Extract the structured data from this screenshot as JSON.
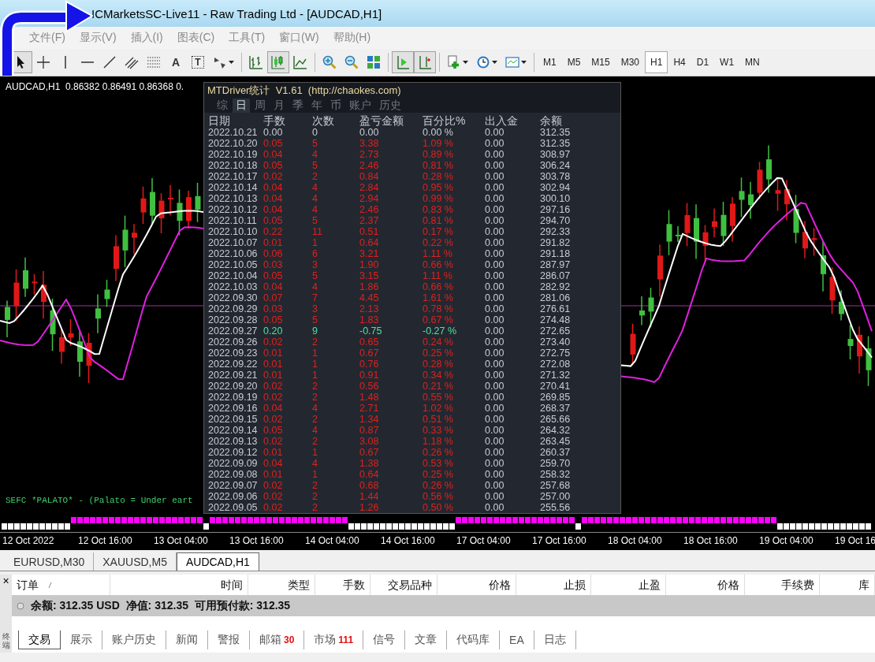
{
  "window": {
    "title": "ICMarketsSC-Live11 - Raw Trading Ltd - [AUDCAD,H1]"
  },
  "menu": [
    "文件(F)",
    "显示(V)",
    "插入(I)",
    "图表(C)",
    "工具(T)",
    "窗口(W)",
    "帮助(H)"
  ],
  "toolbar": {
    "tool_groups": [
      [
        {
          "kind": "cursor",
          "pressed": true
        },
        {
          "kind": "crosshair",
          "pressed": false
        },
        {
          "kind": "vline",
          "pressed": false
        },
        {
          "kind": "hline",
          "pressed": false
        },
        {
          "kind": "trendline",
          "pressed": false
        },
        {
          "kind": "channel",
          "pressed": false
        },
        {
          "kind": "fibo",
          "pressed": false
        },
        {
          "kind": "text",
          "label": "A",
          "pressed": false
        },
        {
          "kind": "textlabel",
          "label": "T",
          "pressed": false
        },
        {
          "kind": "arrows",
          "dropdown": true,
          "pressed": false
        }
      ],
      [
        {
          "kind": "barchart",
          "pressed": false
        },
        {
          "kind": "candles",
          "pressed": true
        },
        {
          "kind": "linechart",
          "pressed": false
        }
      ],
      [
        {
          "kind": "zoomin",
          "pressed": false
        },
        {
          "kind": "zoomout",
          "pressed": false
        },
        {
          "kind": "tile",
          "pressed": false
        }
      ],
      [
        {
          "kind": "autoscroll",
          "pressed": true
        },
        {
          "kind": "shift",
          "pressed": true
        }
      ],
      [
        {
          "kind": "indicators",
          "dropdown": true,
          "pressed": false
        },
        {
          "kind": "periods",
          "dropdown": true,
          "pressed": false
        },
        {
          "kind": "templates",
          "dropdown": true,
          "pressed": false
        }
      ]
    ],
    "timeframes": [
      {
        "label": "M1",
        "selected": false
      },
      {
        "label": "M5",
        "selected": false
      },
      {
        "label": "M15",
        "selected": false
      },
      {
        "label": "M30",
        "selected": false
      },
      {
        "label": "H1",
        "selected": true
      },
      {
        "label": "H4",
        "selected": false
      },
      {
        "label": "D1",
        "selected": false
      },
      {
        "label": "W1",
        "selected": false
      },
      {
        "label": "MN",
        "selected": false
      }
    ]
  },
  "chart": {
    "symbol_info": "AUDCAD,H1  0.86382 0.86491 0.86368 0.",
    "comment": "SEFC *PALATO* - (Palato = Under eart",
    "time_axis": [
      "12 Oct 2022",
      "12 Oct 16:00",
      "13 Oct 04:00",
      "13 Oct 16:00",
      "14 Oct 04:00",
      "14 Oct 16:00",
      "17 Oct 04:00",
      "17 Oct 16:00",
      "18 Oct 04:00",
      "18 Oct 16:00",
      "19 Oct 04:00",
      "19 Oct 16"
    ]
  },
  "stats_panel": {
    "title": "MTDriver统计  V1.61  (http://chaokes.com)",
    "tabs": [
      {
        "label": "综",
        "selected": false
      },
      {
        "label": "日",
        "selected": true
      },
      {
        "label": "周",
        "selected": false
      },
      {
        "label": "月",
        "selected": false
      },
      {
        "label": "季",
        "selected": false
      },
      {
        "label": "年",
        "selected": false
      },
      {
        "label": "币",
        "selected": false
      },
      {
        "label": "账户",
        "selected": false
      },
      {
        "label": "历史",
        "selected": false
      }
    ],
    "columns": [
      "日期",
      "手数",
      "次数",
      "盈亏金额",
      "百分比%",
      "出入金",
      "余额"
    ],
    "rows": [
      {
        "date": "2022.10.21",
        "lots": "0.00",
        "trades": "0",
        "pnl": "0.00",
        "pct": "0.00 %",
        "cash": "0.00",
        "balance": "312.35",
        "color": "#c8ccd4"
      },
      {
        "date": "2022.10.20",
        "lots": "0.05",
        "trades": "5",
        "pnl": "3.38",
        "pct": "1.09 %",
        "cash": "0.00",
        "balance": "312.35",
        "color": "#e0201e"
      },
      {
        "date": "2022.10.19",
        "lots": "0.04",
        "trades": "4",
        "pnl": "2.73",
        "pct": "0.89 %",
        "cash": "0.00",
        "balance": "308.97",
        "color": "#e0201e"
      },
      {
        "date": "2022.10.18",
        "lots": "0.05",
        "trades": "5",
        "pnl": "2.46",
        "pct": "0.81 %",
        "cash": "0.00",
        "balance": "306.24",
        "color": "#e0201e"
      },
      {
        "date": "2022.10.17",
        "lots": "0.02",
        "trades": "2",
        "pnl": "0.84",
        "pct": "0.28 %",
        "cash": "0.00",
        "balance": "303.78",
        "color": "#e0201e"
      },
      {
        "date": "2022.10.14",
        "lots": "0.04",
        "trades": "4",
        "pnl": "2.84",
        "pct": "0.95 %",
        "cash": "0.00",
        "balance": "302.94",
        "color": "#e0201e"
      },
      {
        "date": "2022.10.13",
        "lots": "0.04",
        "trades": "4",
        "pnl": "2.94",
        "pct": "0.99 %",
        "cash": "0.00",
        "balance": "300.10",
        "color": "#e0201e"
      },
      {
        "date": "2022.10.12",
        "lots": "0.04",
        "trades": "4",
        "pnl": "2.46",
        "pct": "0.83 %",
        "cash": "0.00",
        "balance": "297.16",
        "color": "#e0201e"
      },
      {
        "date": "2022.10.11",
        "lots": "0.05",
        "trades": "5",
        "pnl": "2.37",
        "pct": "0.81 %",
        "cash": "0.00",
        "balance": "294.70",
        "color": "#e0201e"
      },
      {
        "date": "2022.10.10",
        "lots": "0.22",
        "trades": "11",
        "pnl": "0.51",
        "pct": "0.17 %",
        "cash": "0.00",
        "balance": "292.33",
        "color": "#e0201e"
      },
      {
        "date": "2022.10.07",
        "lots": "0.01",
        "trades": "1",
        "pnl": "0.64",
        "pct": "0.22 %",
        "cash": "0.00",
        "balance": "291.82",
        "color": "#e0201e"
      },
      {
        "date": "2022.10.06",
        "lots": "0.06",
        "trades": "6",
        "pnl": "3.21",
        "pct": "1.11 %",
        "cash": "0.00",
        "balance": "291.18",
        "color": "#e0201e"
      },
      {
        "date": "2022.10.05",
        "lots": "0.03",
        "trades": "3",
        "pnl": "1.90",
        "pct": "0.66 %",
        "cash": "0.00",
        "balance": "287.97",
        "color": "#e0201e"
      },
      {
        "date": "2022.10.04",
        "lots": "0.05",
        "trades": "5",
        "pnl": "3.15",
        "pct": "1.11 %",
        "cash": "0.00",
        "balance": "286.07",
        "color": "#e0201e"
      },
      {
        "date": "2022.10.03",
        "lots": "0.04",
        "trades": "4",
        "pnl": "1.86",
        "pct": "0.66 %",
        "cash": "0.00",
        "balance": "282.92",
        "color": "#e0201e"
      },
      {
        "date": "2022.09.30",
        "lots": "0.07",
        "trades": "7",
        "pnl": "4.45",
        "pct": "1.61 %",
        "cash": "0.00",
        "balance": "281.06",
        "color": "#e0201e"
      },
      {
        "date": "2022.09.29",
        "lots": "0.03",
        "trades": "3",
        "pnl": "2.13",
        "pct": "0.78 %",
        "cash": "0.00",
        "balance": "276.61",
        "color": "#e0201e"
      },
      {
        "date": "2022.09.28",
        "lots": "0.05",
        "trades": "5",
        "pnl": "1.83",
        "pct": "0.67 %",
        "cash": "0.00",
        "balance": "274.48",
        "color": "#e0201e"
      },
      {
        "date": "2022.09.27",
        "lots": "0.20",
        "trades": "9",
        "pnl": "-0.75",
        "pct": "-0.27 %",
        "cash": "0.00",
        "balance": "272.65",
        "color": "#50e0a0"
      },
      {
        "date": "2022.09.26",
        "lots": "0.02",
        "trades": "2",
        "pnl": "0.65",
        "pct": "0.24 %",
        "cash": "0.00",
        "balance": "273.40",
        "color": "#e0201e"
      },
      {
        "date": "2022.09.23",
        "lots": "0.01",
        "trades": "1",
        "pnl": "0.67",
        "pct": "0.25 %",
        "cash": "0.00",
        "balance": "272.75",
        "color": "#e0201e"
      },
      {
        "date": "2022.09.22",
        "lots": "0.01",
        "trades": "1",
        "pnl": "0.76",
        "pct": "0.28 %",
        "cash": "0.00",
        "balance": "272.08",
        "color": "#e0201e"
      },
      {
        "date": "2022.09.21",
        "lots": "0.01",
        "trades": "1",
        "pnl": "0.91",
        "pct": "0.34 %",
        "cash": "0.00",
        "balance": "271.32",
        "color": "#e0201e"
      },
      {
        "date": "2022.09.20",
        "lots": "0.02",
        "trades": "2",
        "pnl": "0.56",
        "pct": "0.21 %",
        "cash": "0.00",
        "balance": "270.41",
        "color": "#e0201e"
      },
      {
        "date": "2022.09.19",
        "lots": "0.02",
        "trades": "2",
        "pnl": "1.48",
        "pct": "0.55 %",
        "cash": "0.00",
        "balance": "269.85",
        "color": "#e0201e"
      },
      {
        "date": "2022.09.16",
        "lots": "0.04",
        "trades": "4",
        "pnl": "2.71",
        "pct": "1.02 %",
        "cash": "0.00",
        "balance": "268.37",
        "color": "#e0201e"
      },
      {
        "date": "2022.09.15",
        "lots": "0.02",
        "trades": "2",
        "pnl": "1.34",
        "pct": "0.51 %",
        "cash": "0.00",
        "balance": "265.66",
        "color": "#e0201e"
      },
      {
        "date": "2022.09.14",
        "lots": "0.05",
        "trades": "4",
        "pnl": "0.87",
        "pct": "0.33 %",
        "cash": "0.00",
        "balance": "264.32",
        "color": "#e0201e"
      },
      {
        "date": "2022.09.13",
        "lots": "0.02",
        "trades": "2",
        "pnl": "3.08",
        "pct": "1.18 %",
        "cash": "0.00",
        "balance": "263.45",
        "color": "#e0201e"
      },
      {
        "date": "2022.09.12",
        "lots": "0.01",
        "trades": "1",
        "pnl": "0.67",
        "pct": "0.26 %",
        "cash": "0.00",
        "balance": "260.37",
        "color": "#e0201e"
      },
      {
        "date": "2022.09.09",
        "lots": "0.04",
        "trades": "4",
        "pnl": "1.38",
        "pct": "0.53 %",
        "cash": "0.00",
        "balance": "259.70",
        "color": "#e0201e"
      },
      {
        "date": "2022.09.08",
        "lots": "0.01",
        "trades": "1",
        "pnl": "0.64",
        "pct": "0.25 %",
        "cash": "0.00",
        "balance": "258.32",
        "color": "#e0201e"
      },
      {
        "date": "2022.09.07",
        "lots": "0.02",
        "trades": "2",
        "pnl": "0.68",
        "pct": "0.26 %",
        "cash": "0.00",
        "balance": "257.68",
        "color": "#e0201e"
      },
      {
        "date": "2022.09.06",
        "lots": "0.02",
        "trades": "2",
        "pnl": "1.44",
        "pct": "0.56 %",
        "cash": "0.00",
        "balance": "257.00",
        "color": "#e0201e"
      },
      {
        "date": "2022.09.05",
        "lots": "0.02",
        "trades": "2",
        "pnl": "1.26",
        "pct": "0.50 %",
        "cash": "0.00",
        "balance": "255.56",
        "color": "#e0201e"
      }
    ]
  },
  "chart_tabs": [
    {
      "label": "EURUSD,M30",
      "selected": false
    },
    {
      "label": "XAUUSD,M5",
      "selected": false
    },
    {
      "label": "AUDCAD,H1",
      "selected": true
    }
  ],
  "terminal": {
    "close": "×",
    "side_label": "终端",
    "columns": [
      "订单",
      "时间",
      "类型",
      "手数",
      "交易品种",
      "价格",
      "止损",
      "止盈",
      "价格",
      "手续费",
      "库"
    ],
    "balance": "余额: 312.35 USD  净值: 312.35  可用预付款: 312.35",
    "tabs": [
      {
        "label": "交易",
        "selected": true
      },
      {
        "label": "展示",
        "selected": false
      },
      {
        "label": "账户历史",
        "selected": false
      },
      {
        "label": "新闻",
        "selected": false
      },
      {
        "label": "警报",
        "selected": false
      },
      {
        "label": "邮箱",
        "badge": "30",
        "selected": false
      },
      {
        "label": "市场",
        "badge": "111",
        "selected": false
      },
      {
        "label": "信号",
        "selected": false
      },
      {
        "label": "文章",
        "selected": false
      },
      {
        "label": "代码库",
        "selected": false
      },
      {
        "label": "EA",
        "selected": false
      },
      {
        "label": "日志",
        "selected": false
      }
    ]
  }
}
